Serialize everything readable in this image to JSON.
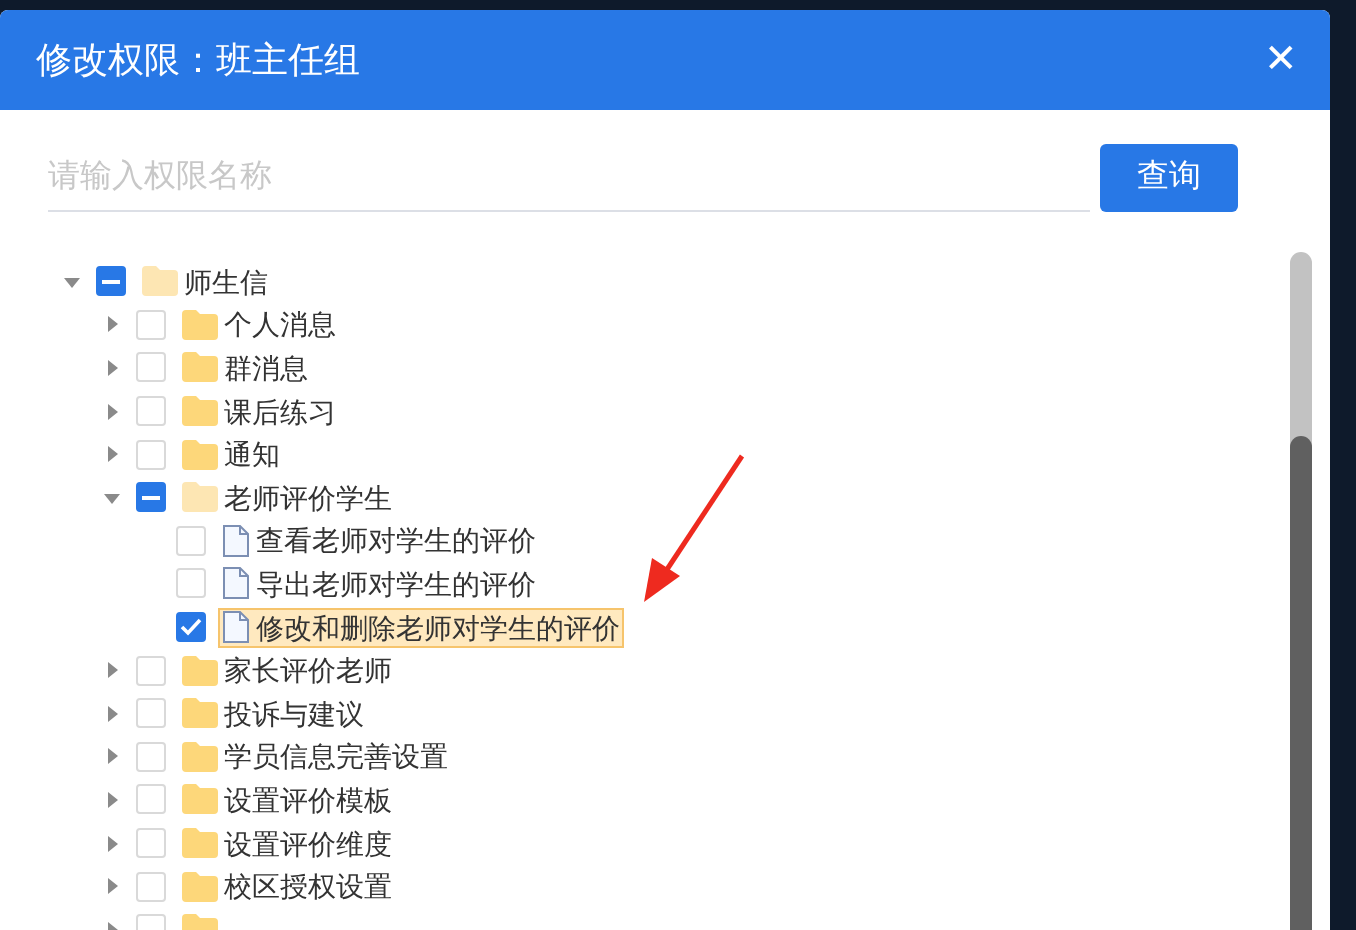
{
  "dialog": {
    "title": "修改权限：班主任组",
    "close": "✕"
  },
  "search": {
    "placeholder": "请输入权限名称",
    "button": "查询"
  },
  "tree": [
    {
      "label": "师生信",
      "kind": "folder",
      "expanded": true,
      "indeterminate": true,
      "selected": false,
      "children": [
        {
          "label": "个人消息",
          "kind": "folder",
          "expanded": false,
          "checked": false,
          "indeterminate": false,
          "selected": false
        },
        {
          "label": "群消息",
          "kind": "folder",
          "expanded": false,
          "checked": false,
          "indeterminate": false,
          "selected": false
        },
        {
          "label": "课后练习",
          "kind": "folder",
          "expanded": false,
          "checked": false,
          "indeterminate": false,
          "selected": false
        },
        {
          "label": "通知",
          "kind": "folder",
          "expanded": false,
          "checked": false,
          "indeterminate": false,
          "selected": false
        },
        {
          "label": "老师评价学生",
          "kind": "folder",
          "expanded": true,
          "indeterminate": true,
          "selected": false,
          "children": [
            {
              "label": "查看老师对学生的评价",
              "kind": "file",
              "checked": false,
              "indeterminate": false,
              "selected": false
            },
            {
              "label": "导出老师对学生的评价",
              "kind": "file",
              "checked": false,
              "indeterminate": false,
              "selected": false
            },
            {
              "label": "修改和删除老师对学生的评价",
              "kind": "file",
              "checked": true,
              "selected": true
            }
          ]
        },
        {
          "label": "家长评价老师",
          "kind": "folder",
          "expanded": false,
          "checked": false,
          "indeterminate": false,
          "selected": false
        },
        {
          "label": "投诉与建议",
          "kind": "folder",
          "expanded": false,
          "checked": false,
          "indeterminate": false,
          "selected": false
        },
        {
          "label": "学员信息完善设置",
          "kind": "folder",
          "expanded": false,
          "checked": false,
          "indeterminate": false,
          "selected": false
        },
        {
          "label": "设置评价模板",
          "kind": "folder",
          "expanded": false,
          "checked": false,
          "indeterminate": false,
          "selected": false
        },
        {
          "label": "设置评价维度",
          "kind": "folder",
          "expanded": false,
          "checked": false,
          "indeterminate": false,
          "selected": false
        },
        {
          "label": "校区授权设置",
          "kind": "folder",
          "expanded": false,
          "checked": false,
          "indeterminate": false,
          "selected": false
        },
        {
          "kind": "folder",
          "expanded": false,
          "checked": false,
          "indeterminate": false,
          "selected": false
        }
      ]
    }
  ]
}
